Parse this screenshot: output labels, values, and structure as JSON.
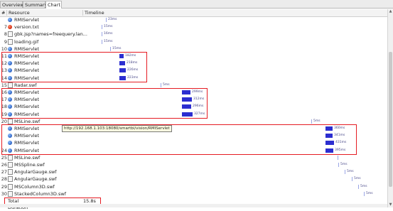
{
  "tabs": [
    "Overview",
    "Summary",
    "Chart"
  ],
  "columns": {
    "num": "#",
    "resource": "Resource",
    "timeline": "Timeline"
  },
  "tooltip": "http://192.168.1.103:18080/smartbi/vision/RMIServlet",
  "total": {
    "label": "Total Duration",
    "value": "15.8s"
  },
  "colors": {
    "highlight": "#e51c23",
    "bar": "#2c2ed0"
  },
  "rows": [
    {
      "n": "",
      "icon": "globe-icon",
      "name": "RMIServlet",
      "dur": "23ms"
    },
    {
      "n": "7",
      "icon": "error-icon",
      "name": "version.txt",
      "dur": "15ms"
    },
    {
      "n": "8",
      "icon": "file-icon",
      "name": "gbk.jsp?names=freequery.lan...",
      "dur": "16ms"
    },
    {
      "n": "9",
      "icon": "file-icon",
      "name": "loading.gif",
      "dur": "15ms"
    },
    {
      "n": "10",
      "icon": "globe-icon",
      "name": "RMIServlet",
      "dur": "15ms"
    },
    {
      "n": "11",
      "icon": "globe-icon",
      "name": "RMIServlet",
      "dur": "182ms"
    },
    {
      "n": "12",
      "icon": "globe-icon",
      "name": "RMIServlet",
      "dur": "218ms"
    },
    {
      "n": "13",
      "icon": "globe-icon",
      "name": "RMIServlet",
      "dur": "226ms"
    },
    {
      "n": "14",
      "icon": "globe-icon",
      "name": "RMIServlet",
      "dur": "223ms"
    },
    {
      "n": "15",
      "icon": "file-icon",
      "name": "Radar.swf",
      "dur": "5ms"
    },
    {
      "n": "16",
      "icon": "globe-icon",
      "name": "RMIServlet",
      "dur": "299ms"
    },
    {
      "n": "17",
      "icon": "globe-icon",
      "name": "RMIServlet",
      "dur": "312ms"
    },
    {
      "n": "18",
      "icon": "globe-icon",
      "name": "RMIServlet",
      "dur": "296ms"
    },
    {
      "n": "19",
      "icon": "globe-icon",
      "name": "RMIServlet",
      "dur": "327ms"
    },
    {
      "n": "20",
      "icon": "file-icon",
      "name": "MSLine.swf",
      "dur": "5ms"
    },
    {
      "n": "",
      "icon": "globe-icon",
      "name": "RMIServlet",
      "dur": "360ms"
    },
    {
      "n": "",
      "icon": "globe-icon",
      "name": "RMIServlet",
      "dur": "341ms"
    },
    {
      "n": "",
      "icon": "globe-icon",
      "name": "RMIServlet",
      "dur": "431ms"
    },
    {
      "n": "24",
      "icon": "globe-icon",
      "name": "RMIServlet",
      "dur": "395ms"
    },
    {
      "n": "25",
      "icon": "file-icon",
      "name": "MSLine.swf",
      "dur": ""
    },
    {
      "n": "26",
      "icon": "file-icon",
      "name": "MSSpline.swf",
      "dur": "5ms"
    },
    {
      "n": "27",
      "icon": "file-icon",
      "name": "AngularGauge.swf",
      "dur": "5ms"
    },
    {
      "n": "28",
      "icon": "file-icon",
      "name": "AngularGauge.swf",
      "dur": "5ms"
    },
    {
      "n": "29",
      "icon": "file-icon",
      "name": "MSColumn3D.swf",
      "dur": "5ms"
    },
    {
      "n": "30",
      "icon": "file-icon",
      "name": "StackedColumn3D.swf",
      "dur": "5ms"
    }
  ]
}
